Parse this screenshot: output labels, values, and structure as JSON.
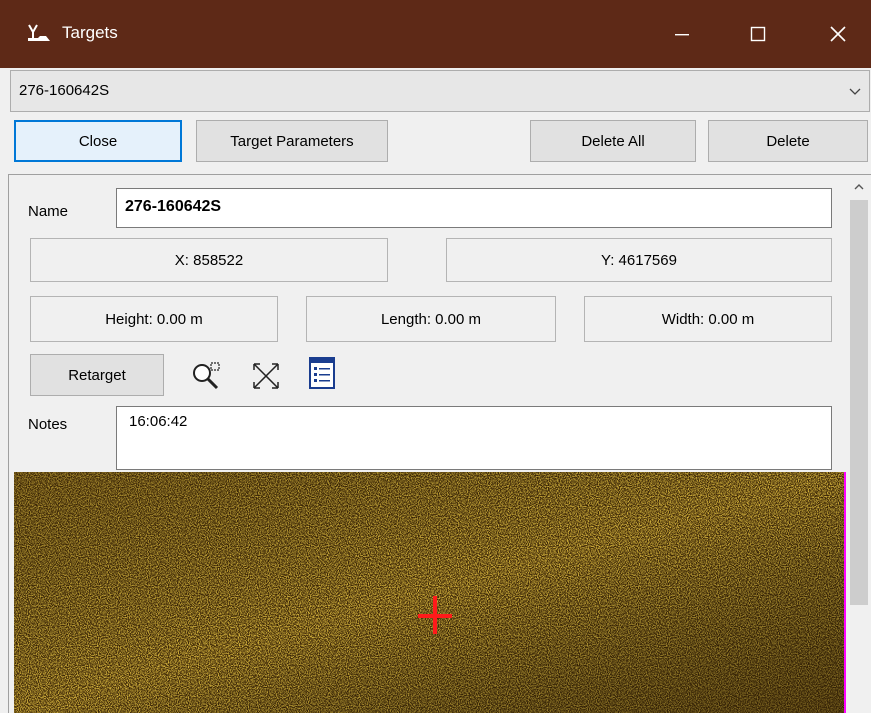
{
  "window": {
    "title": "Targets",
    "minimize_icon": "minimize-icon",
    "maximize_icon": "maximize-icon",
    "close_icon": "close-icon",
    "titlebar_color": "#5e2917"
  },
  "target_select": {
    "value": "276-160642S"
  },
  "toolbar": {
    "close_label": "Close",
    "target_params_label": "Target Parameters",
    "delete_all_label": "Delete All",
    "delete_label": "Delete"
  },
  "details": {
    "name_label": "Name",
    "name_value": "276-160642S",
    "x_text": "X: 858522",
    "y_text": "Y: 4617569",
    "height_text": "Height: 0.00 m",
    "length_text": "Length: 0.00 m",
    "width_text": "Width: 0.00 m",
    "retarget_label": "Retarget",
    "notes_label": "Notes",
    "notes_value": "16:06:42"
  },
  "tools": [
    "zoom-window-icon",
    "fit-extents-icon",
    "list-details-icon"
  ],
  "colors": {
    "sonar": "#b07a10",
    "crosshair": "#ff1a1a",
    "sonar_edge": "#ff00ff"
  }
}
